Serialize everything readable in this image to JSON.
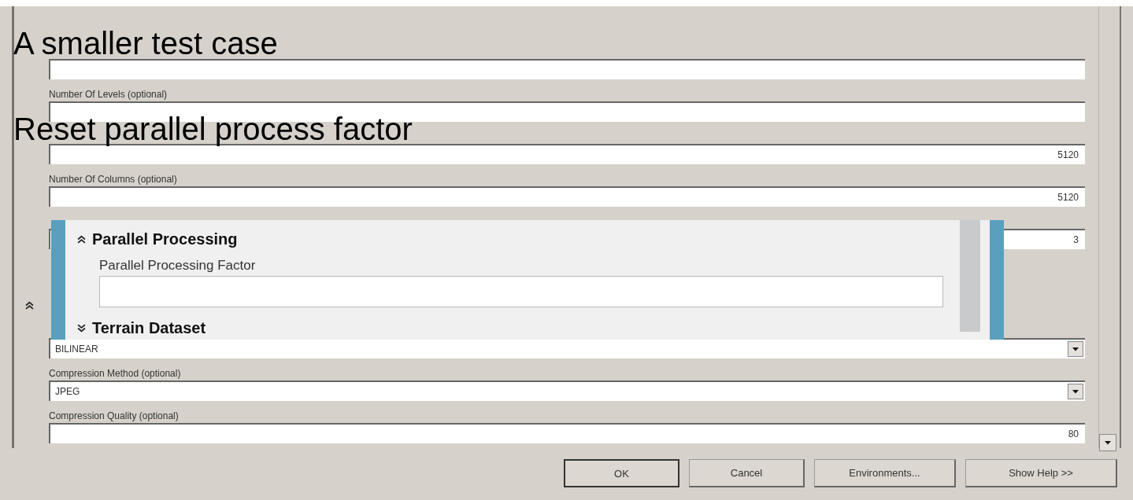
{
  "captions": [
    "A smaller test case",
    "Reset parallel process factor"
  ],
  "dialog": {
    "fields": [
      {
        "kind": "text"
      },
      {
        "kind": "text",
        "label": "Number Of Levels (optional)"
      },
      {
        "kind": "text",
        "value": "5120"
      },
      {
        "kind": "text",
        "label": "Number Of Columns (optional)",
        "value": "5120"
      },
      {
        "kind": "text",
        "value": "3"
      },
      {
        "kind": "section",
        "expanded": true
      },
      {
        "kind": "dropdown",
        "value": "BILINEAR"
      },
      {
        "kind": "dropdown",
        "label": "Compression Method (optional)",
        "value": "JPEG"
      },
      {
        "kind": "text",
        "label": "Compression Quality (optional)",
        "value": "80"
      }
    ],
    "buttons": [
      {
        "label": "OK",
        "default": true
      },
      {
        "label": "Cancel",
        "default": false
      },
      {
        "label": "Environments...",
        "default": false
      },
      {
        "label": "Show Help >>",
        "default": false
      }
    ]
  },
  "inset": {
    "sections": [
      {
        "title": "Parallel Processing",
        "expanded": true,
        "fields": [
          {
            "label": "Parallel Processing Factor"
          }
        ]
      },
      {
        "title": "Terrain Dataset",
        "expanded": false
      }
    ]
  }
}
